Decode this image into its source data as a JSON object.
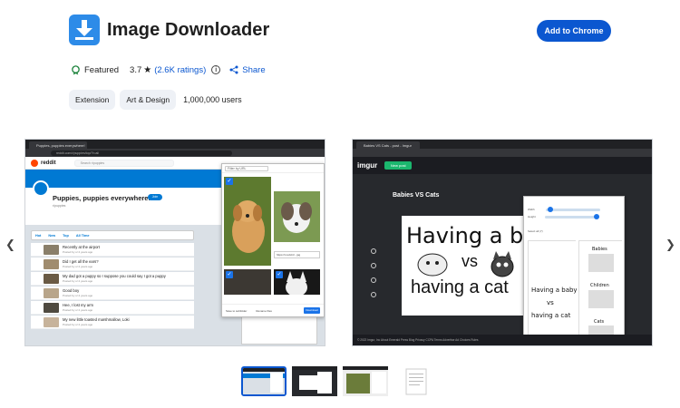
{
  "app": {
    "title": "Image Downloader",
    "add_button": "Add to Chrome",
    "featured": "Featured",
    "rating": "3.7",
    "ratings_link": "(2.6K ratings)",
    "share": "Share",
    "chips": [
      "Extension",
      "Art & Design"
    ],
    "users": "1,000,000 users"
  },
  "colors": {
    "accent": "#0b57d0",
    "icon_bg": "#2d8be8"
  },
  "carousel": {
    "prev_icon": "chevron-left-icon",
    "next_icon": "chevron-right-icon",
    "selected_thumb": 0
  },
  "shot1": {
    "tab": "Puppies, puppies everywhere!",
    "url": "reddit.com/r/puppies/top/?t=all",
    "logo": "reddit",
    "search": "Search r/puppies",
    "sub_title": "Puppies, puppies everywhere!",
    "sub_name": "r/puppies",
    "join": "Join",
    "sort": [
      "Hot",
      "New",
      "Top",
      "All Time"
    ],
    "posts": [
      {
        "title": "Recently at the airport",
        "meta": "Posted by u/ 2 years ago"
      },
      {
        "title": "Did I get all the ears?",
        "meta": "Posted by u/ 2 years ago"
      },
      {
        "title": "My dad got a puppy so I suppose you could say I got a puppy",
        "meta": "Posted by u/ 2 years ago"
      },
      {
        "title": "Good boy",
        "meta": "Posted by u/ 2 years ago"
      },
      {
        "title": "Hee, I lost my arm",
        "meta": "Posted by u/ 2 years ago"
      },
      {
        "title": "My new little toasted marshmallow, Loki",
        "meta": "Posted by u/ 2 years ago"
      }
    ],
    "popup_filter": "Filter by URL",
    "popup_url": "https://i.redd.it/...jpg",
    "popup_save": "Save to subfolder",
    "popup_rename": "Rename files",
    "popup_download": "Download"
  },
  "shot2": {
    "tab": "Babies VS Cats - post - Imgur",
    "logo": "imgur",
    "new_post": "New post",
    "title": "Babies VS Cats",
    "image_line1": "Having a baby",
    "image_vs": "vs",
    "image_line2": "having a cat",
    "popup_width": "Width",
    "popup_height": "Height",
    "popup_select_all": "Select all (7)",
    "popup_download": "Download",
    "footer": "© 2022 Imgur, Inc  About  Emerald  Press  Blog  Privacy  CCPA  Terms  Advertise  Ad Choices  Rules"
  }
}
